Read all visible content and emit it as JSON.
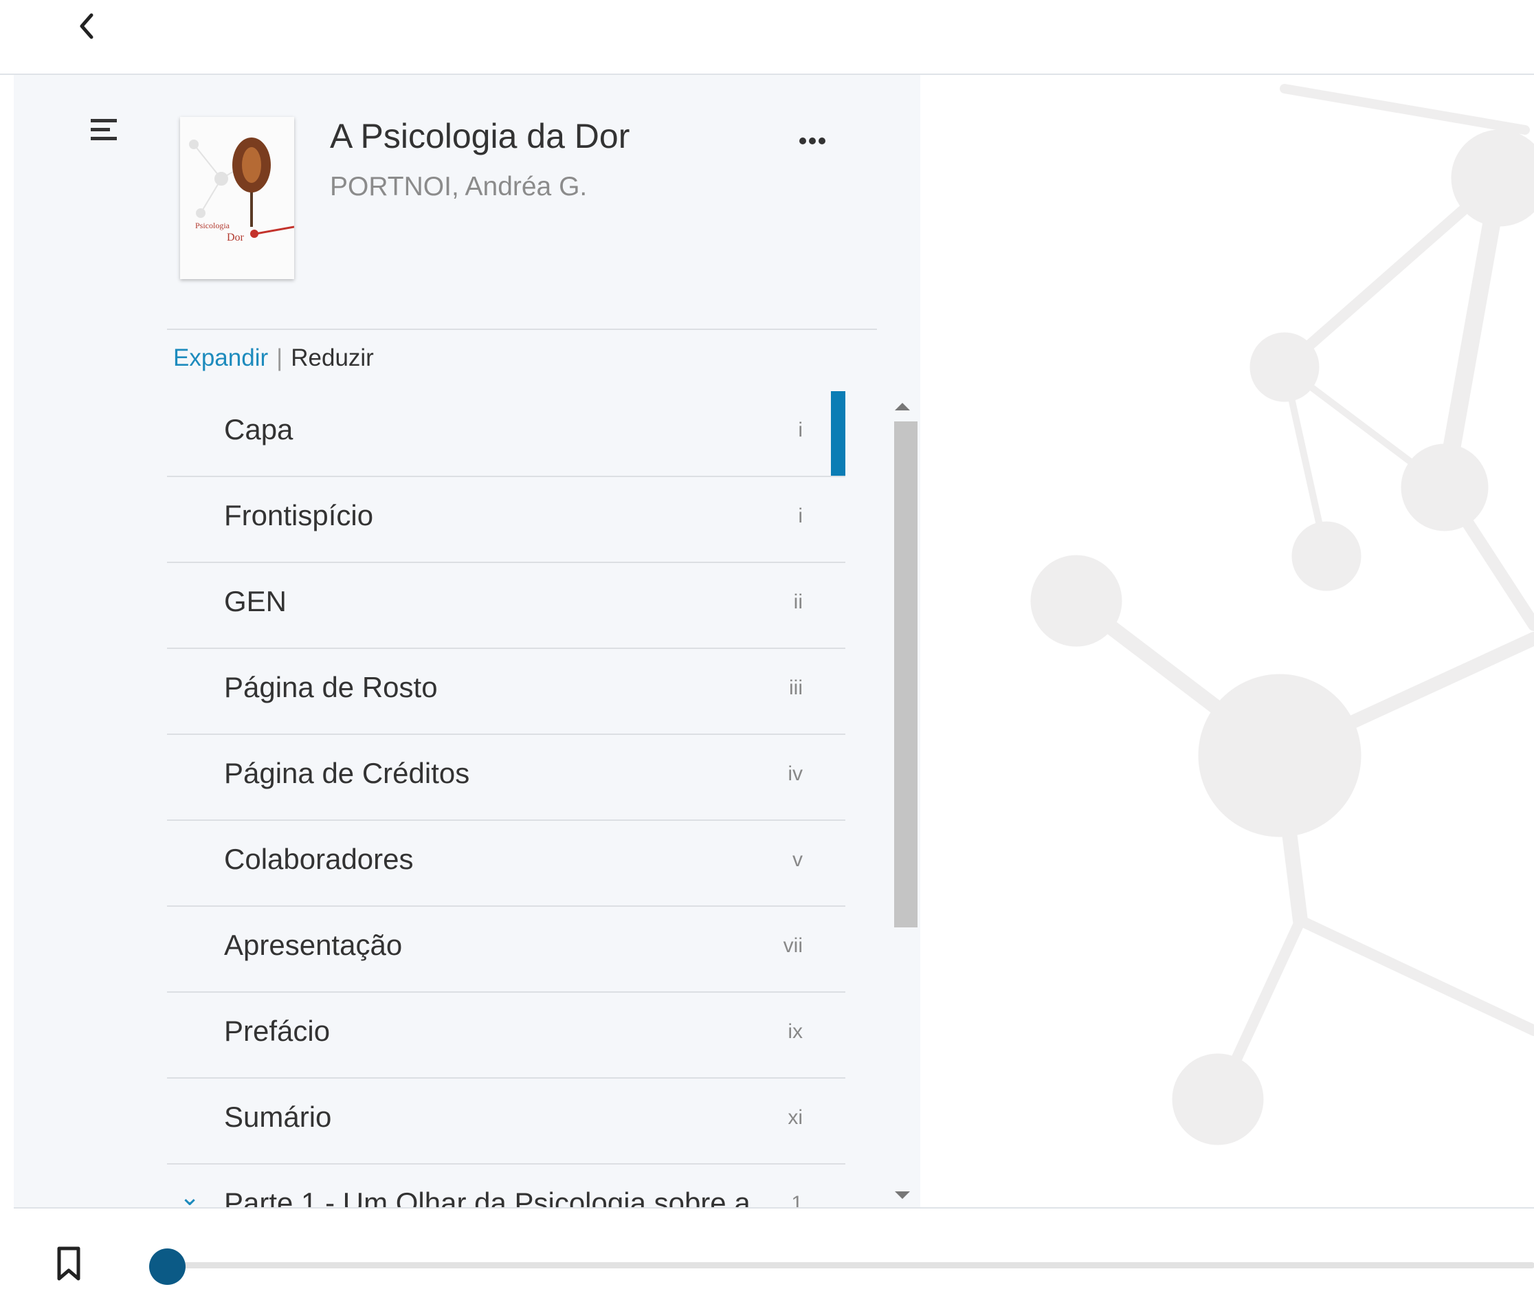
{
  "header": {
    "back_icon": "chevron-left-icon"
  },
  "book": {
    "title": "A Psicologia da Dor",
    "author": "PORTNOI, Andréa G.",
    "cover_icon": "book-cover-image"
  },
  "sidebar": {
    "menu_icon": "menu-lines-icon",
    "more_icon": "more-horizontal-icon",
    "expand_label": "Expandir",
    "separator": "|",
    "reduce_label": "Reduzir"
  },
  "toc": [
    {
      "label": "Capa",
      "page": "i",
      "active": true
    },
    {
      "label": "Frontispício",
      "page": "i"
    },
    {
      "label": "GEN",
      "page": "ii"
    },
    {
      "label": "Página de Rosto",
      "page": "iii"
    },
    {
      "label": "Página de Créditos",
      "page": "iv"
    },
    {
      "label": "Colaboradores",
      "page": "v"
    },
    {
      "label": "Apresentação",
      "page": "vii"
    },
    {
      "label": "Prefácio",
      "page": "ix"
    },
    {
      "label": "Sumário",
      "page": "xi"
    },
    {
      "label": "Parte 1 - Um Olhar da Psicologia sobre a",
      "page": "1",
      "expandable": true
    }
  ],
  "footer": {
    "bookmark_icon": "bookmark-icon",
    "progress": 0.0
  },
  "colors": {
    "accent": "#1d8bbd",
    "active_marker": "#0b7db5",
    "progress_knob": "#0b5a86",
    "sidebar_bg": "#f5f7fa"
  }
}
